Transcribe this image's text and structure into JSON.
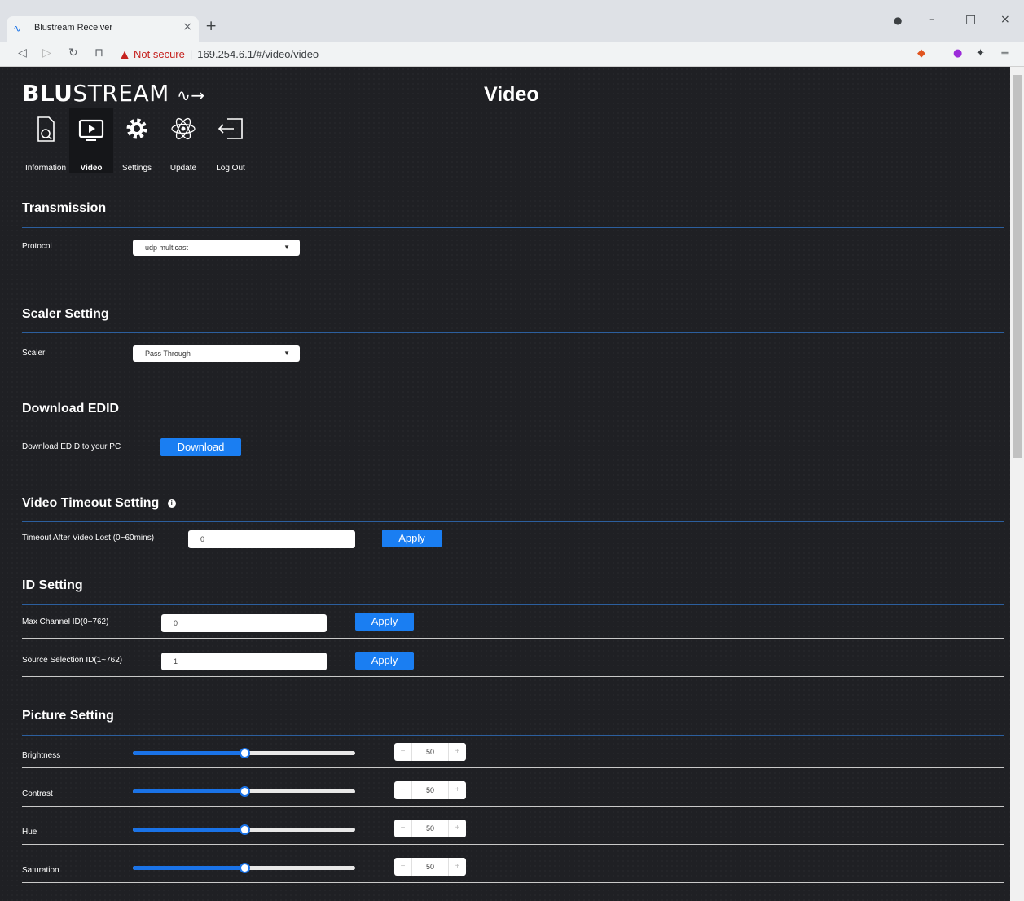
{
  "browser": {
    "tab_title": "Blustream Receiver",
    "not_secure": "Not secure",
    "url": "169.254.6.1/#/video/video"
  },
  "logo": {
    "bold": "BLU",
    "light": "STREAM"
  },
  "page_title": "Video",
  "nav": [
    {
      "label": "Information",
      "icon": "document-search-icon"
    },
    {
      "label": "Video",
      "icon": "play-screen-icon"
    },
    {
      "label": "Settings",
      "icon": "gear-icon"
    },
    {
      "label": "Update",
      "icon": "atom-icon"
    },
    {
      "label": "Log Out",
      "icon": "logout-icon"
    }
  ],
  "transmission": {
    "title": "Transmission",
    "protocol_label": "Protocol",
    "protocol_value": "udp multicast"
  },
  "scaler": {
    "title": "Scaler Setting",
    "label": "Scaler",
    "value": "Pass Through"
  },
  "edid": {
    "title": "Download EDID",
    "label": "Download EDID to your PC",
    "button": "Download"
  },
  "timeout": {
    "title": "Video Timeout Setting",
    "label": "Timeout After Video Lost (0~60mins)",
    "value": "0",
    "button": "Apply"
  },
  "id_setting": {
    "title": "ID Setting",
    "max_label": "Max Channel ID(0~762)",
    "max_value": "0",
    "max_button": "Apply",
    "source_label": "Source Selection ID(1~762)",
    "source_value": "1",
    "source_button": "Apply"
  },
  "picture": {
    "title": "Picture Setting",
    "sliders": [
      {
        "label": "Brightness",
        "value": "50",
        "fraction": 0.5
      },
      {
        "label": "Contrast",
        "value": "50",
        "fraction": 0.5
      },
      {
        "label": "Hue",
        "value": "50",
        "fraction": 0.5
      },
      {
        "label": "Saturation",
        "value": "50",
        "fraction": 0.5
      }
    ]
  },
  "colors": {
    "accent": "#1a7ef2",
    "background": "#1f2024",
    "rule": "#2c5f9e"
  }
}
